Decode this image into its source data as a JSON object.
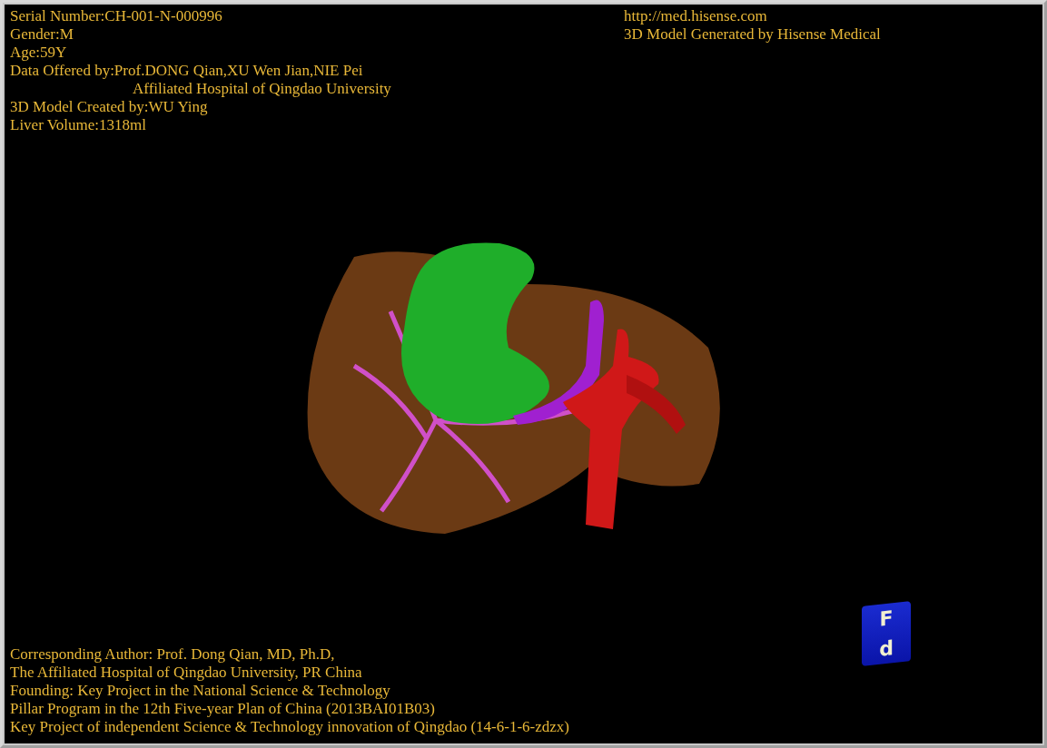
{
  "info_top_left": [
    "Serial Number:CH-001-N-000996",
    "Gender:M",
    "Age:59Y",
    "Data Offered by:Prof.DONG Qian,XU Wen Jian,NIE Pei"
  ],
  "info_indented": "Affiliated Hospital of Qingdao University",
  "info_more": [
    "3D Model Created by:WU Ying",
    "Liver Volume:1318ml"
  ],
  "info_top_right": [
    "http://med.hisense.com",
    "3D Model Generated by Hisense Medical"
  ],
  "credits": [
    "Corresponding Author: Prof. Dong Qian, MD, Ph.D,",
    "The Affiliated Hospital of Qingdao University, PR China",
    "Founding: Key Project in the National Science & Technology",
    "Pillar Program in the 12th Five-year Plan of China (2013BAI01B03)",
    "Key Project of independent Science & Technology innovation of Qingdao (14-6-1-6-zdzx)"
  ],
  "orientation_cube": {
    "front": "F",
    "bottom": "d"
  }
}
